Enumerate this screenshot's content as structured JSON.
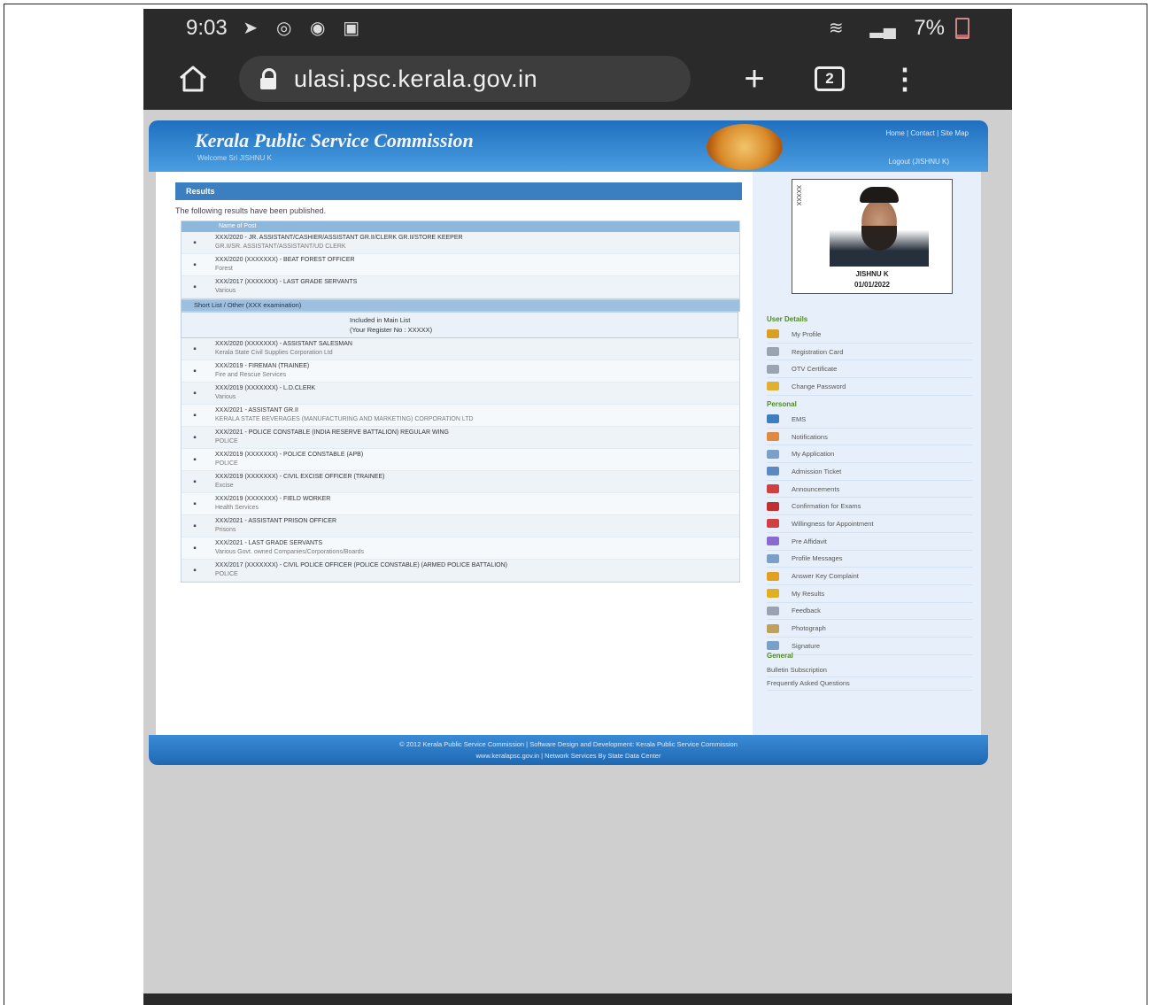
{
  "status_bar": {
    "time": "9:03",
    "battery": "7%",
    "icons": [
      "telegram-icon",
      "instagram-icon",
      "reddit-icon",
      "gallery-icon",
      "wifi-icon",
      "signal-icon",
      "signal-icon",
      "battery-icon"
    ]
  },
  "browser": {
    "url": "ulasi.psc.kerala.gov.in",
    "tab_count": "2"
  },
  "site": {
    "title": "Kerala Public Service Commission",
    "welcome": "Welcome   Sri JISHNU K",
    "top_links": "Home | Contact | Site Map",
    "logout": "Logout (JISHNU K)"
  },
  "results": {
    "heading": "Results",
    "intro": "The following results have been published.",
    "table_header": "Name of Post",
    "rows_top": [
      {
        "title": "XXX/2020 - JR. ASSISTANT/CASHIER/ASSISTANT GR.II/CLERK GR.II/STORE KEEPER",
        "sub": "GR.II/SR. ASSISTANT/ASSISTANT/UD CLERK"
      },
      {
        "title": "XXX/2020 (XXXXXXX) - BEAT FOREST OFFICER",
        "sub": "Forest"
      },
      {
        "title": "XXX/2017 (XXXXXXX) - LAST GRADE SERVANTS",
        "sub": "Various"
      }
    ],
    "shortlist_header": "Short List / Other (XXX examination)",
    "main_list_label": "Included in Main List",
    "register_no": "(Your Register No : XXXXX)",
    "rows_bottom": [
      {
        "title": "XXX/2020 (XXXXXXX) - ASSISTANT SALESMAN",
        "sub": "Kerala State Civil Supplies Corporation Ltd"
      },
      {
        "title": "XXX/2019 - FIREMAN (TRAINEE)",
        "sub": "Fire and Rescue Services"
      },
      {
        "title": "XXX/2019 (XXXXXXX) - L.D.CLERK",
        "sub": "Various"
      },
      {
        "title": "XXX/2021 - ASSISTANT GR.II",
        "sub": "KERALA STATE BEVERAGES (MANUFACTURING AND MARKETING) CORPORATION LTD"
      },
      {
        "title": "XXX/2021 - POLICE CONSTABLE (INDIA RESERVE BATTALION) REGULAR WING",
        "sub": "POLICE"
      },
      {
        "title": "XXX/2019 (XXXXXXX) - POLICE CONSTABLE (APB)",
        "sub": "POLICE"
      },
      {
        "title": "XXX/2019 (XXXXXXX) - CIVIL EXCISE OFFICER (TRAINEE)",
        "sub": "Excise"
      },
      {
        "title": "XXX/2019 (XXXXXXX) - FIELD WORKER",
        "sub": "Health Services"
      },
      {
        "title": "XXX/2021 - ASSISTANT PRISON OFFICER",
        "sub": "Prisons"
      },
      {
        "title": "XXX/2021 - LAST GRADE SERVANTS",
        "sub": "Various Govt. owned Companies/Corporations/Boards"
      },
      {
        "title": "XXX/2017 (XXXXXXX) - CIVIL POLICE OFFICER (POLICE CONSTABLE) (ARMED POLICE BATTALION)",
        "sub": "POLICE"
      }
    ]
  },
  "profile": {
    "name": "JISHNU K",
    "date": "01/01/2022",
    "photo_number": "XXXXX"
  },
  "sidebar": {
    "user_details_title": "User Details",
    "user_details": [
      {
        "label": "My Profile",
        "icon": "profile-icon",
        "color": "#d8a020"
      },
      {
        "label": "Registration Card",
        "icon": "card-icon",
        "color": "#9aa4b0"
      },
      {
        "label": "OTV Certificate",
        "icon": "certificate-icon",
        "color": "#9aa4b0"
      },
      {
        "label": "Change Password",
        "icon": "key-icon",
        "color": "#e0b030"
      }
    ],
    "personal_title": "Personal",
    "personal": [
      {
        "label": "EMS",
        "icon": "chart-icon",
        "color": "#3c7fc0"
      },
      {
        "label": "Notifications",
        "icon": "bell-icon",
        "color": "#e08a40"
      },
      {
        "label": "My Application",
        "icon": "application-icon",
        "color": "#7aa0c8"
      },
      {
        "label": "Admission Ticket",
        "icon": "ticket-icon",
        "color": "#5a8ac0"
      },
      {
        "label": "Announcements",
        "icon": "megaphone-icon",
        "color": "#d04040"
      },
      {
        "label": "Confirmation for Exams",
        "icon": "confirm-icon",
        "color": "#c03030"
      },
      {
        "label": "Willingness for Appointment",
        "icon": "pen-icon",
        "color": "#d04040"
      },
      {
        "label": "Pre Affidavit",
        "icon": "edit-icon",
        "color": "#8a6ad0"
      },
      {
        "label": "Profile Messages",
        "icon": "message-icon",
        "color": "#7aa0c8"
      },
      {
        "label": "Answer Key Complaint",
        "icon": "pencil-icon",
        "color": "#e0a020"
      },
      {
        "label": "My Results",
        "icon": "results-icon",
        "color": "#e0b020"
      },
      {
        "label": "Feedback",
        "icon": "feedback-icon",
        "color": "#9aa4b0"
      },
      {
        "label": "Photograph",
        "icon": "photo-icon",
        "color": "#c0a060"
      },
      {
        "label": "Signature",
        "icon": "signature-icon",
        "color": "#7aa0c8"
      }
    ],
    "general_title": "General",
    "general": [
      {
        "label": "Bulletin Subscription"
      },
      {
        "label": "Frequently Asked Questions"
      }
    ]
  },
  "footer": {
    "line1": "© 2012 Kerala Public Service Commission | Software Design and Development: Kerala Public Service Commission",
    "line2": "www.keralapsc.gov.in | Network Services By State Data Center"
  }
}
